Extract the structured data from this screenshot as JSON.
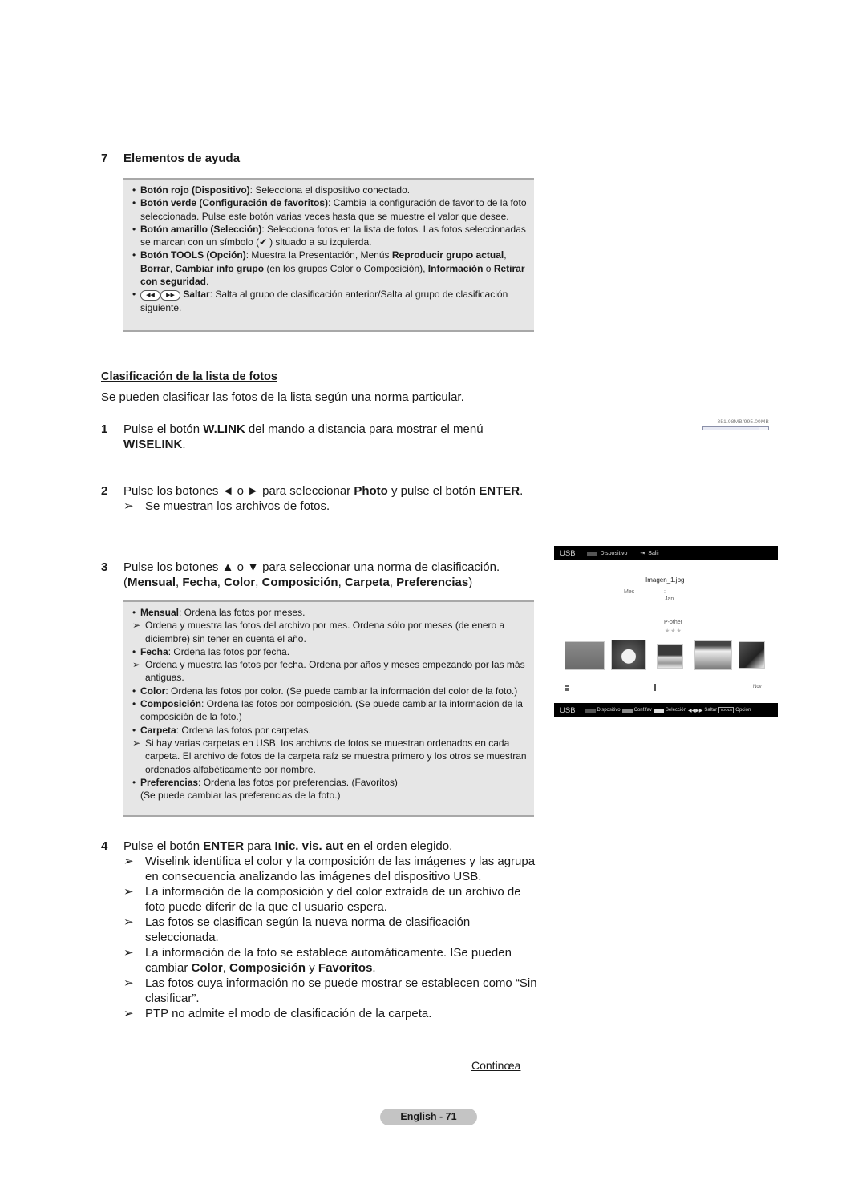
{
  "section7": {
    "number": "7",
    "title": "Elementos de ayuda",
    "items": [
      {
        "bold": "Botón rojo (Dispositivo)",
        "text": ": Selecciona el dispositivo conectado."
      },
      {
        "bold": "Botón verde (Configuración de favoritos)",
        "text": ": Cambia la configuración de favorito de la foto seleccionada. Pulse este botón varias veces hasta que se muestre el valor que desee."
      },
      {
        "bold": "Botón amarillo (Selección)",
        "text_a": ": Selecciona fotos en la lista de fotos. Las fotos seleccionadas se marcan con un símbolo (",
        "check_icon": "✔",
        "text_b": ") situado a su izquierda."
      },
      {
        "bold": "Botón TOOLS (Opción)",
        "t1": ": Muestra la Presentación, Menús ",
        "b1": "Reproducir grupo actual",
        "t2": ", ",
        "b2": "Borrar",
        "t3": ", ",
        "b3": "Cambiar info grupo",
        "t4": " (en los grupos Color o Composición), ",
        "b4": "Información",
        "t5": " o ",
        "b5": "Retirar con seguridad",
        "t6": "."
      },
      {
        "rew_icon": "◀◀",
        "ff_icon": "▶▶",
        "bold": "Saltar",
        "text": ": Salta al grupo de clasificación anterior/Salta al grupo de clasificación siguiente."
      }
    ]
  },
  "sorting": {
    "title": "Clasificación de la lista de fotos",
    "intro": "Se pueden clasificar las fotos de la lista según una norma particular.",
    "arrow": "➢",
    "step1": {
      "n": "1",
      "t1": "Pulse el botón ",
      "b1": "W.LINK",
      "t2": " del mando a distancia para mostrar el menú ",
      "b2": "WISELINK",
      "t3": "."
    },
    "step2": {
      "n": "2",
      "t1": "Pulse los botones ◄ o ► para seleccionar ",
      "b1": "Photo",
      "t2": " y pulse el botón ",
      "b2": "ENTER",
      "t3": ".",
      "note": "Se muestran los archivos de fotos."
    },
    "step3": {
      "n": "3",
      "t1": "Pulse los botones ▲ o ▼ para seleccionar una norma de clasificación.",
      "open": "(",
      "b1": "Mensual",
      "b2": "Fecha",
      "b3": "Color",
      "b4": "Composición",
      "b5": "Carpeta",
      "b6": "Preferencias",
      "close": ")",
      "sep": ", "
    },
    "criteria": [
      {
        "bold": "Mensual",
        "text": ": Ordena las fotos por meses.",
        "note": "Ordena y muestra las fotos del archivo por mes. Ordena sólo por meses (de enero a diciembre) sin tener en cuenta el año."
      },
      {
        "bold": "Fecha",
        "text": ": Ordena las fotos por fecha.",
        "note": "Ordena y muestra las fotos por fecha. Ordena por años y meses empezando por las más antiguas."
      },
      {
        "bold": "Color",
        "text": ": Ordena las fotos por color. (Se puede cambiar la información del color de la foto.)"
      },
      {
        "bold": "Composición",
        "text": ": Ordena las fotos por composición. (Se puede cambiar la información de la composición de la foto.)"
      },
      {
        "bold": "Carpeta",
        "text": ": Ordena las fotos por carpetas.",
        "note": "Si hay varias carpetas en USB, los archivos de fotos se muestran ordenados en cada carpeta. El archivo de fotos de la carpeta raíz se muestra primero y los otros se muestran ordenados alfabéticamente por nombre."
      },
      {
        "bold": "Preferencias",
        "text": ": Ordena las fotos por preferencias. (Favoritos)",
        "extra": "(Se puede cambiar las preferencias de la foto.)"
      }
    ],
    "step4": {
      "n": "4",
      "t1": "Pulse el botón ",
      "b1": "ENTER",
      "t2": " para ",
      "b2": "Inic. vis. aut",
      "t3": " en el orden elegido.",
      "notes": [
        "Wiselink identifica el color y la composición de las imágenes y las agrupa en consecuencia analizando las imágenes del dispositivo USB.",
        "La información de la composición y del color extraída de un archivo de foto puede diferir de la que el usuario espera.",
        "Las fotos se clasifican según la nueva norma de clasificación seleccionada."
      ],
      "note4": {
        "t1": "La información de la foto se establece automáticamente. ISe pueden cambiar ",
        "b1": "Color",
        "t2": ", ",
        "b2": "Composición",
        "t3": " y ",
        "b3": "Favoritos",
        "t4": "."
      },
      "notes_after": [
        "Las fotos cuya información no se puede mostrar se establecen como “Sin clasificar”.",
        "PTP no admite el modo de clasificación de la carpeta."
      ]
    }
  },
  "continue_label": "Continœa",
  "page_label": "English - 71",
  "storage": {
    "text": "851.98MB/995.00MB",
    "used_fraction": 0.856
  },
  "tv": {
    "top": {
      "usb": "USB",
      "device": "Dispositivo",
      "exit_icon": "⇥",
      "exit": "Salir",
      "device_color": "#555555"
    },
    "filename": "Imagen_1.jpg",
    "sort_label": "Mes",
    "colon": ":",
    "sort_value": "Jan",
    "preference": "P-other",
    "stars": "★★★",
    "thumbnails": [
      "sheep",
      "flower",
      "sky-clouds",
      "snowy-mountain",
      "tree-sky"
    ],
    "next_group": "Nov",
    "bottom": {
      "usb": "USB",
      "device": "Dispositivo",
      "fav": "Conf.fav",
      "select": "Selección",
      "skip_icon": "◀◀▶▶",
      "skip": "Saltar",
      "tools": "TOOLS",
      "option": "Opción",
      "device_color": "#555555",
      "fav_color": "#8a8a8a",
      "select_color": "#dddddd"
    }
  }
}
